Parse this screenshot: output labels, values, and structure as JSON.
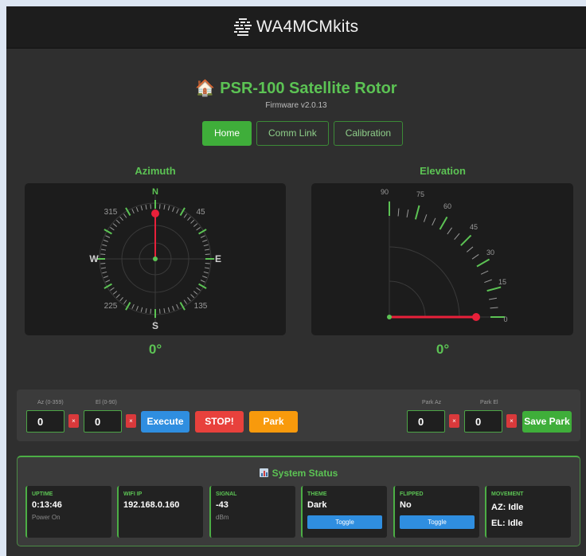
{
  "header": {
    "brand": "WA4MCMkits",
    "brand_icon": "grid-logo-icon"
  },
  "page": {
    "title_icon": "🏠",
    "title": "PSR-100 Satellite Rotor",
    "firmware": "Firmware v2.0.13"
  },
  "tabs": [
    {
      "label": "Home",
      "active": true
    },
    {
      "label": "Comm Link",
      "active": false
    },
    {
      "label": "Calibration",
      "active": false
    }
  ],
  "azimuth": {
    "label": "Azimuth",
    "value_text": "0°",
    "value": 0,
    "cardinals": {
      "n": "N",
      "e": "E",
      "s": "S",
      "w": "W"
    },
    "ticks": {
      "t45": "45",
      "t135": "135",
      "t225": "225",
      "t315": "315"
    }
  },
  "elevation": {
    "label": "Elevation",
    "value_text": "0°",
    "value": 0,
    "ticks": {
      "t0": "0",
      "t15": "15",
      "t30": "30",
      "t45": "45",
      "t60": "60",
      "t75": "75",
      "t90": "90"
    }
  },
  "controls": {
    "az_label": "Az (0-359)",
    "az_value": "0",
    "el_label": "El (0-90)",
    "el_value": "0",
    "clear": "×",
    "execute": "Execute",
    "stop": "STOP!",
    "park": "Park",
    "park_az_label": "Park Az",
    "park_az_value": "0",
    "park_el_label": "Park El",
    "park_el_value": "0",
    "save_park": "Save Park"
  },
  "status": {
    "title": "System Status",
    "cards": {
      "uptime": {
        "key": "UPTIME",
        "value": "0:13:46",
        "sub": "Power On"
      },
      "wifi": {
        "key": "WIFI IP",
        "value": "192.168.0.160"
      },
      "signal": {
        "key": "SIGNAL",
        "value": "-43",
        "sub": "dBm"
      },
      "theme": {
        "key": "THEME",
        "value": "Dark",
        "button": "Toggle"
      },
      "flipped": {
        "key": "FLIPPED",
        "value": "No",
        "button": "Toggle"
      },
      "movement": {
        "key": "MOVEMENT",
        "az": "AZ: Idle",
        "el": "EL: Idle"
      }
    }
  },
  "colors": {
    "accent": "#5cc354",
    "needle": "#e8203a",
    "stop": "#e8413c",
    "park": "#f89a0c",
    "execute": "#2f8ee0"
  }
}
